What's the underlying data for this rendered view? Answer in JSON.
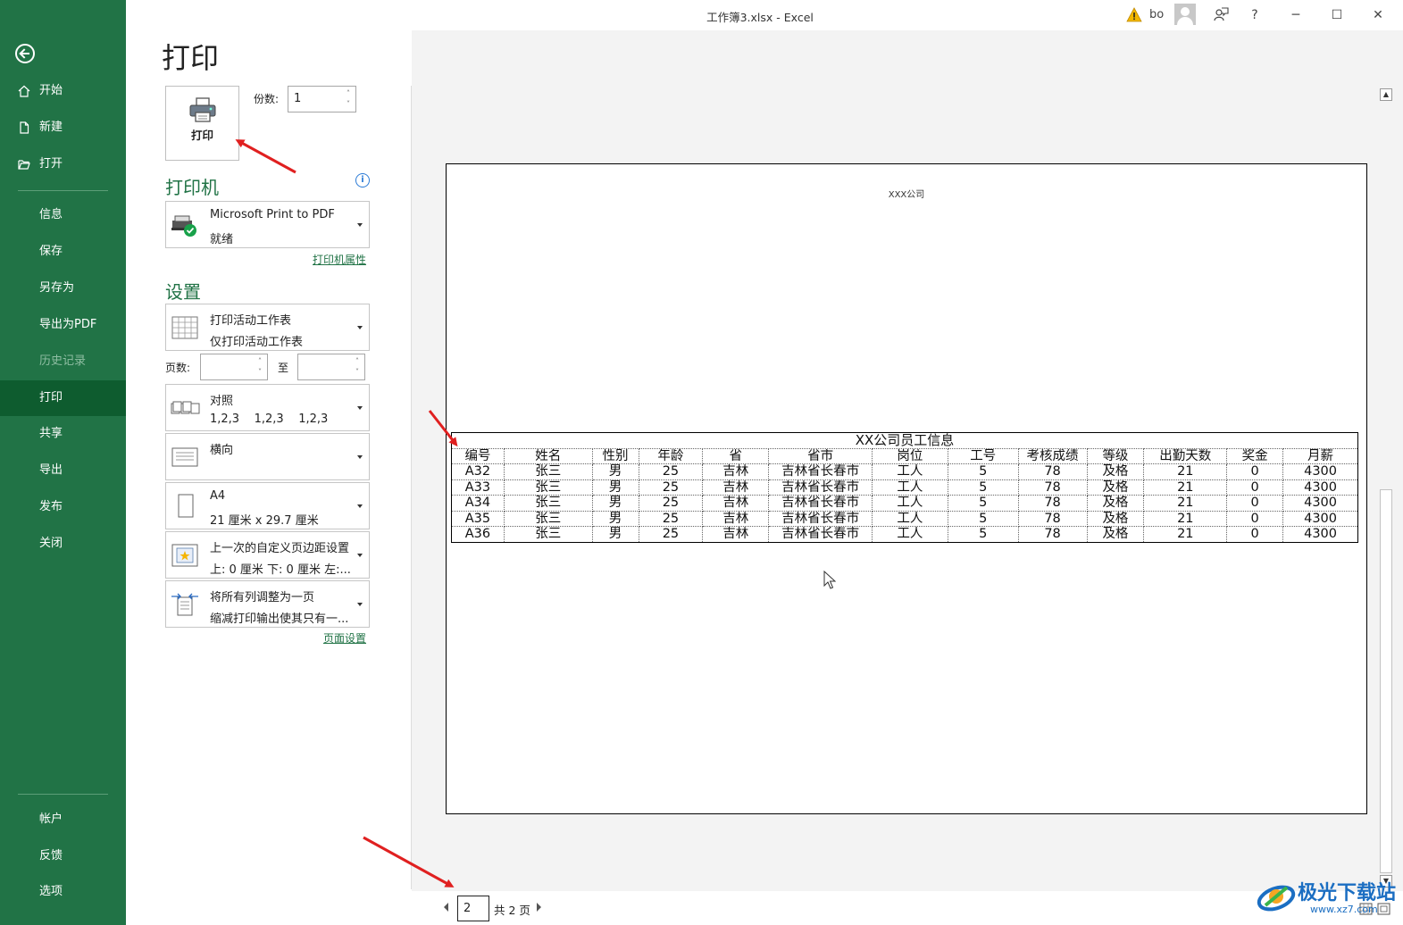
{
  "window": {
    "title": "工作簿3.xlsx  -  Excel",
    "user": "bo",
    "help": "?",
    "minimize": "─",
    "maximize": "☐",
    "close": "✕"
  },
  "sidebar": {
    "items": [
      {
        "label": "开始"
      },
      {
        "label": "新建"
      },
      {
        "label": "打开"
      },
      {
        "label": "信息"
      },
      {
        "label": "保存"
      },
      {
        "label": "另存为"
      },
      {
        "label": "导出为PDF"
      },
      {
        "label": "历史记录"
      },
      {
        "label": "打印"
      },
      {
        "label": "共享"
      },
      {
        "label": "导出"
      },
      {
        "label": "发布"
      },
      {
        "label": "关闭"
      },
      {
        "label": "帐户"
      },
      {
        "label": "反馈"
      },
      {
        "label": "选项"
      }
    ]
  },
  "print": {
    "page_title": "打印",
    "print_button": "打印",
    "copies_label": "份数:",
    "copies_value": "1",
    "printer_section": "打印机",
    "printer_name": "Microsoft Print to PDF",
    "printer_status": "就绪",
    "printer_properties": "打印机属性",
    "settings_section": "设置",
    "scope_line1": "打印活动工作表",
    "scope_line2": "仅打印活动工作表",
    "pages_label": "页数:",
    "to_label": "至",
    "collate_line1": "对照",
    "collate_line2": "1,2,3    1,2,3    1,2,3",
    "orientation": "横向",
    "paper_line1": "A4",
    "paper_line2": "21 厘米 x 29.7 厘米",
    "margins_line1": "上一次的自定义页边距设置",
    "margins_line2": "上: 0 厘米 下: 0 厘米 左:...",
    "scaling_line1": "将所有列调整为一页",
    "scaling_line2": "缩减打印输出使其只有一...",
    "page_setup": "页面设置"
  },
  "preview": {
    "header": "XXX公司",
    "table_title": "XX公司员工信息",
    "columns": [
      "编号",
      "姓名",
      "性别",
      "年龄",
      "省",
      "省市",
      "岗位",
      "工号",
      "考核成绩",
      "等级",
      "出勤天数",
      "奖金",
      "月薪"
    ],
    "rows": [
      [
        "A32",
        "张三",
        "男",
        "25",
        "吉林",
        "吉林省长春市",
        "工人",
        "5",
        "78",
        "及格",
        "21",
        "0",
        "4300"
      ],
      [
        "A33",
        "张三",
        "男",
        "25",
        "吉林",
        "吉林省长春市",
        "工人",
        "5",
        "78",
        "及格",
        "21",
        "0",
        "4300"
      ],
      [
        "A34",
        "张三",
        "男",
        "25",
        "吉林",
        "吉林省长春市",
        "工人",
        "5",
        "78",
        "及格",
        "21",
        "0",
        "4300"
      ],
      [
        "A35",
        "张三",
        "男",
        "25",
        "吉林",
        "吉林省长春市",
        "工人",
        "5",
        "78",
        "及格",
        "21",
        "0",
        "4300"
      ],
      [
        "A36",
        "张三",
        "男",
        "25",
        "吉林",
        "吉林省长春市",
        "工人",
        "5",
        "78",
        "及格",
        "21",
        "0",
        "4300"
      ]
    ]
  },
  "pager": {
    "current_page": "2",
    "total": "共 2 页"
  },
  "watermark": {
    "name": "极光下载站",
    "url": "www.xz7.com"
  },
  "colors": {
    "sidebar": "#217346",
    "sidebar_active": "#0e5c2f",
    "accent": "#217346",
    "arrow": "#e02020"
  },
  "icons": [
    "back-arrow-icon",
    "home-icon",
    "new-file-icon",
    "open-folder-icon",
    "printer-icon",
    "info-icon",
    "warning-icon",
    "avatar-icon",
    "coauthoring-icon"
  ]
}
